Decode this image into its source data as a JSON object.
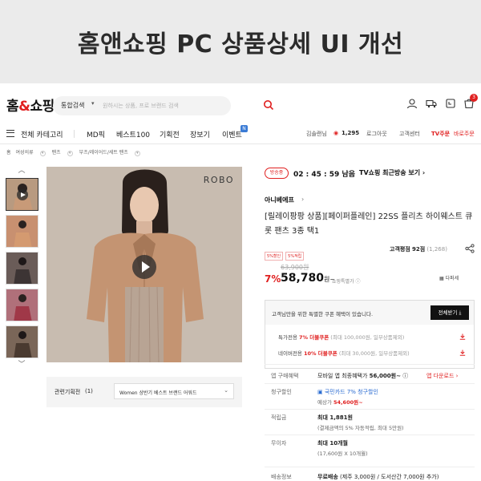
{
  "banner": {
    "title": "홈앤쇼핑  PC 상품상세 UI 개선"
  },
  "header": {
    "logo_prefix": "홈",
    "logo_amp": "&",
    "logo_suffix": "쇼핑",
    "search": {
      "scope": "통합검색",
      "placeholder": "원하시는 상품, 프로 브랜드 검색"
    },
    "cart_count": "3"
  },
  "nav": {
    "all_categories": "전체 카테고리",
    "items": [
      "MD픽",
      "베스트100",
      "기획전",
      "장보기",
      "이벤트"
    ],
    "new_badge": "N",
    "user": "김솔랜님",
    "points": "1,295",
    "logout": "로그아웃",
    "customer_center": "고객센터",
    "tv_order": "TV주문",
    "quick_order": "바로주문"
  },
  "breadcrumb": [
    "홈",
    "여성의류",
    "팬츠",
    "부츠/레이어드/세트 팬츠"
  ],
  "thumbnails": {
    "count": 5,
    "colors": [
      "#b89a80",
      "#c89070",
      "#5a4a48",
      "#a84a50",
      "#6a5648"
    ]
  },
  "main_image": {
    "brand_mark": "ROBO"
  },
  "related": {
    "label": "관련기획전",
    "count": "(1)",
    "selected": "Women 상반기 베스트 브랜드 어워드"
  },
  "product": {
    "timer_badge": "방송중",
    "timer": "02 : 45 : 59 남음",
    "tv_link": "TV쇼핑 최근방송 보기",
    "brand": "아니베에프",
    "title": "[릴레이팡팡 상품][페이퍼플레인] 22SS 플리츠 하이웨스트 큐롯 팬츠 3종 택1",
    "tags": [
      "5%할인",
      "5%적립"
    ],
    "rating_label": "고객평점",
    "rating_score": "92점",
    "review_count": "(1,268)",
    "original_price": "63,900원",
    "discount": "7%",
    "price": "58,780",
    "price_unit": "원~",
    "price_note": "쇼핑특별가",
    "card_discount": "다퍼세"
  },
  "coupon": {
    "header": "고객님만을 위한 특별한 쿠폰 혜택이 있습니다.",
    "download_all": "전체받기",
    "rows": [
      {
        "name": "특가전용",
        "rate": "7% 더블쿠폰",
        "limit": "(최대 100,000원, 일부상품제외)"
      },
      {
        "name": "네이버전용",
        "rate": "10% 더블쿠폰",
        "limit": "(최대 30,000원, 일부상품제외)"
      }
    ]
  },
  "info": {
    "app_benefit_label": "앱 구매혜택",
    "app_benefit_val": "모바일 앱 최종혜택가",
    "app_benefit_price": "56,000원~",
    "app_download": "앱 다운로드",
    "card_label": "청구할인",
    "card_val": "국민카드 7% 청구할인",
    "card_expected": "예상가",
    "card_price": "54,600원~",
    "points_label": "적립금",
    "points_val": "최대 1,881원",
    "points_sub": "(결제금액의 5% 자동적립, 최대 5만원)",
    "installment_label": "무이자",
    "installment_val": "최대 10개월",
    "installment_sub": "(17,600원 X 10개월)",
    "shipping_label": "배송정보",
    "shipping_val": "무료배송",
    "shipping_sub": "(제주 3,000원 / 도서산간 7,000원 추가)"
  }
}
